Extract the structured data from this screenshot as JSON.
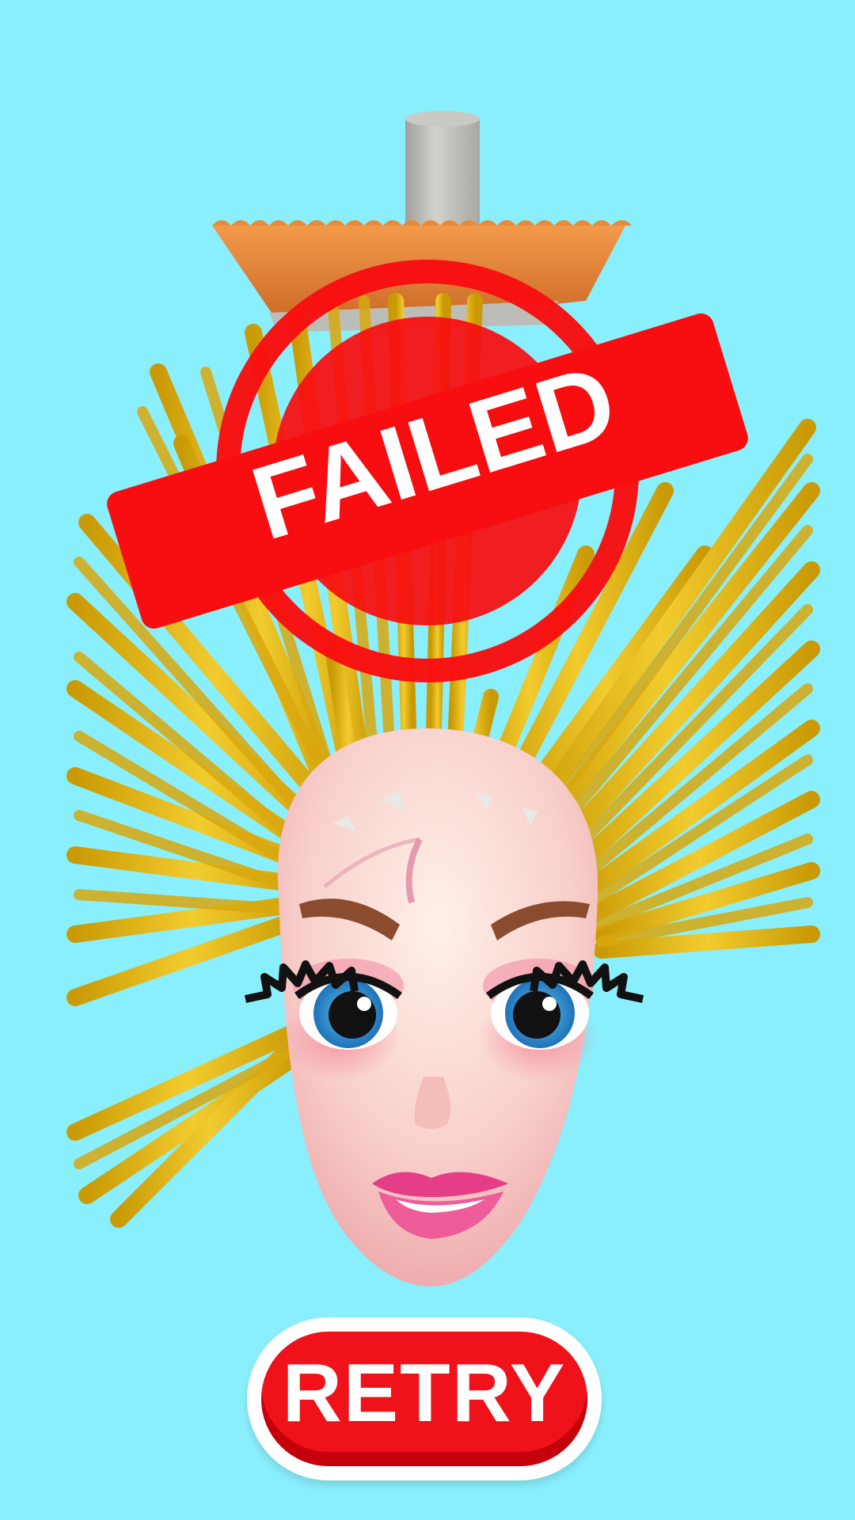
{
  "status": {
    "stamp_label": "FAILED"
  },
  "retry_button": {
    "label": "RETRY"
  },
  "colors": {
    "background": "#8AEFFC",
    "accent_red": "#F0121A",
    "hair_gold": "#E0B21A",
    "skin": "#F7C9C6",
    "brush_orange": "#E98A3A"
  },
  "icons": {
    "stamp": "failed-stamp-icon",
    "character": "doll-head",
    "tool": "brush-tool"
  }
}
